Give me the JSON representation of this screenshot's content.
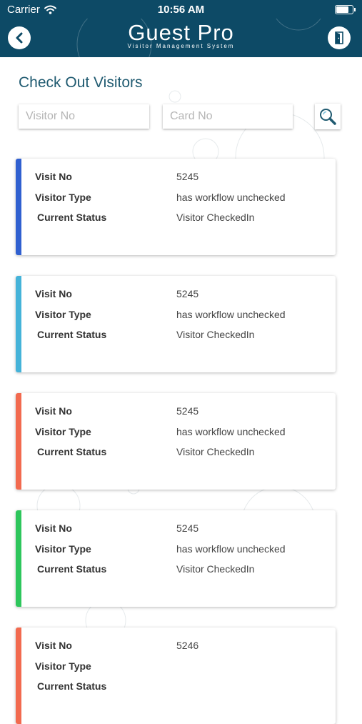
{
  "status_bar": {
    "carrier": "Carrier",
    "time": "10:56 AM",
    "battery_level": 0.9
  },
  "header": {
    "title": "Guest Pro",
    "subtitle": "Visitor Management System",
    "back_icon": "chevron-left-icon",
    "exit_icon": "door-exit-icon",
    "color": "#0d4a66"
  },
  "page": {
    "title": "Check Out Visitors"
  },
  "search": {
    "visitor_no_placeholder": "Visitor No",
    "card_no_placeholder": "Card No",
    "icon": "search-icon"
  },
  "labels": {
    "visit_no": "Visit No",
    "visitor_type": "Visitor Type",
    "current_status": "Current Status"
  },
  "cards": [
    {
      "visit_no": "5245",
      "visitor_type": "has workflow unchecked",
      "current_status": "Visitor CheckedIn",
      "accent": "#3060d0"
    },
    {
      "visit_no": "5245",
      "visitor_type": "has workflow unchecked",
      "current_status": "Visitor CheckedIn",
      "accent": "#45b3d9"
    },
    {
      "visit_no": "5245",
      "visitor_type": "has workflow unchecked",
      "current_status": "Visitor CheckedIn",
      "accent": "#f26a4f"
    },
    {
      "visit_no": "5245",
      "visitor_type": "has workflow unchecked",
      "current_status": "Visitor CheckedIn",
      "accent": "#2ec65c"
    },
    {
      "visit_no": "5246",
      "visitor_type": "",
      "current_status": "",
      "accent": "#f26a4f"
    }
  ]
}
